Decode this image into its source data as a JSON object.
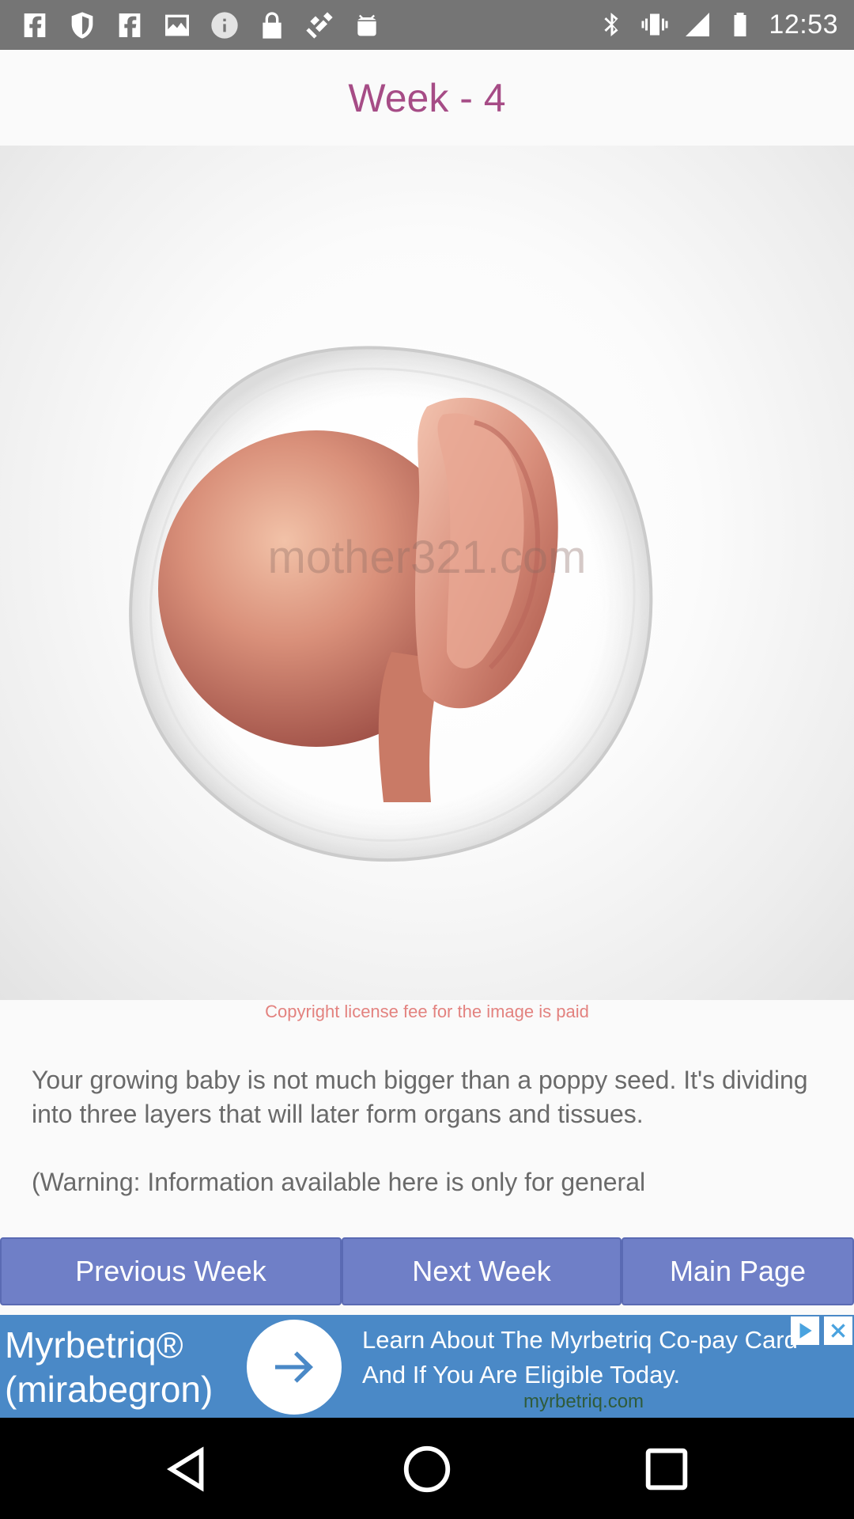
{
  "status_bar": {
    "time": "12:53",
    "left_icons": [
      "facebook-icon",
      "shield-icon",
      "facebook-icon",
      "photo-icon",
      "info-icon",
      "lock-icon",
      "satellite-icon",
      "android-icon"
    ],
    "right_icons": [
      "bluetooth-icon",
      "vibrate-icon",
      "signal-icon",
      "battery-icon"
    ]
  },
  "header": {
    "title": "Week - 4"
  },
  "image": {
    "watermark": "mother321.com",
    "copyright": "Copyright license fee for the image is paid"
  },
  "description": {
    "paragraph": "Your growing baby is not much bigger than a poppy seed. It's dividing into three layers that will later form organs and tissues.",
    "warning": "(Warning: Information available here is only for general"
  },
  "nav": {
    "previous": "Previous Week",
    "next": "Next Week",
    "main": "Main Page"
  },
  "ad": {
    "brand_line1": "Myrbetriq®",
    "brand_line2": "(mirabegron)",
    "headline": "Learn About The Myrbetriq Co-pay Card And If You Are Eligible Today.",
    "domain": "myrbetriq.com"
  },
  "colors": {
    "title": "#a64c86",
    "button": "#6f7fc7",
    "copyright": "#e3827f",
    "ad_background": "#4a89c7"
  }
}
